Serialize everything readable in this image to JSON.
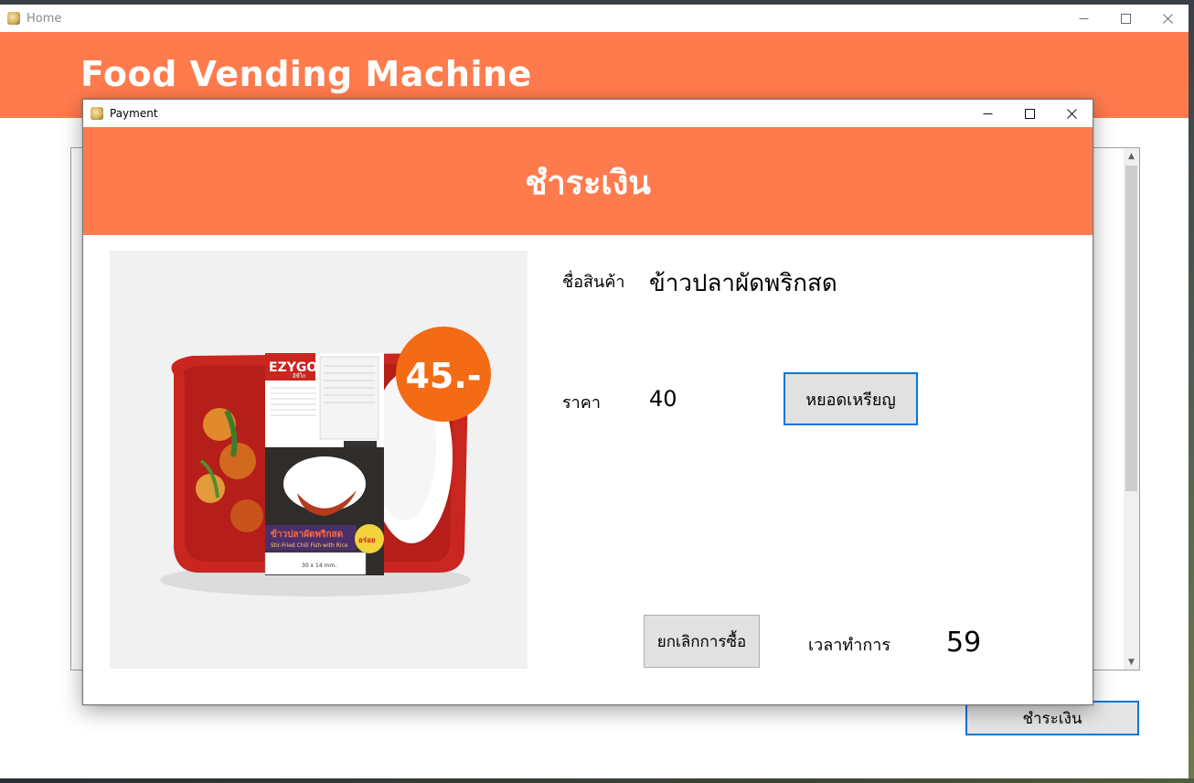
{
  "home": {
    "window_title": "Home",
    "brand": "Food Vending Machine",
    "pay_button": "ชำระเงิน"
  },
  "payment": {
    "window_title": "Payment",
    "heading": "ชำระเงิน",
    "product": {
      "name_label": "ชื่อสินค้า",
      "name_value": "ข้าวปลาผัดพริกสด",
      "price_label": "ราคา",
      "price_value": "40",
      "image_price_badge": "45.-",
      "package_brand": "EZYGO",
      "package_brand_sub": "อีซี่โก",
      "package_dish_thai": "ข้าวปลาผัดพริกสด",
      "package_dish_en": "Stir-Fried Chili Fish with Rice",
      "package_weight": "230",
      "package_tag": "อร่อย",
      "package_size": "30 x 14 mm."
    },
    "insert_coin_button": "หยอดเหรียญ",
    "cancel_button": "ยกเลิกการซื้อ",
    "time_label": "เวลาทำการ",
    "time_value": "59"
  },
  "colors": {
    "accent": "#ff7b4d",
    "focus_border": "#0078d7",
    "button_bg": "#e1e1e1"
  },
  "icons": {
    "app": "app-icon",
    "minimize": "minimize-icon",
    "maximize": "maximize-icon",
    "close": "close-icon"
  }
}
